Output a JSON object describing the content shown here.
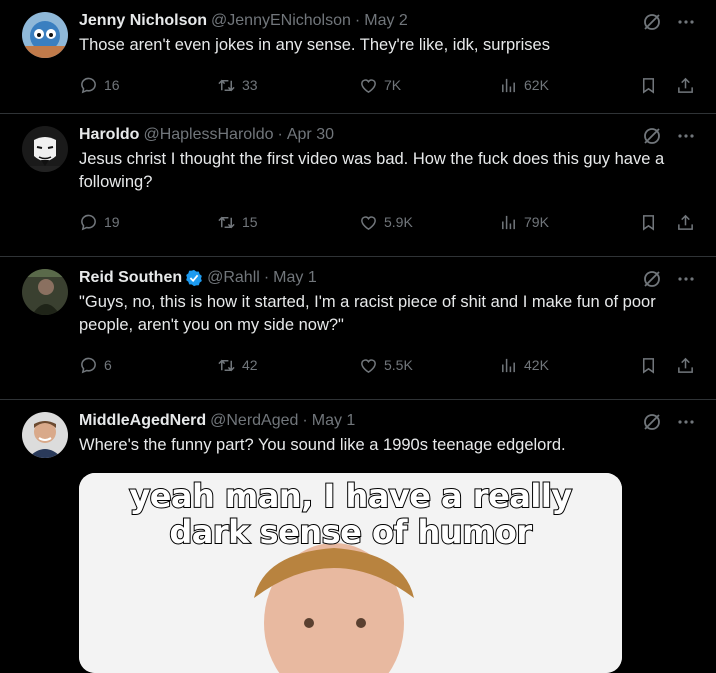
{
  "tweets": [
    {
      "name": "Jenny Nicholson",
      "handle": "@JennyENicholson",
      "date": "May 2",
      "verified": false,
      "text": "Those aren't even jokes in any sense. They're like, idk, surprises",
      "replies": "16",
      "retweets": "33",
      "likes": "7K",
      "views": "62K",
      "avatar": "avatar-photo"
    },
    {
      "name": "Haroldo",
      "handle": "@HaplessHaroldo",
      "date": "Apr 30",
      "verified": false,
      "text": "Jesus christ I thought the first video was bad. How the fuck does this guy have a following?",
      "replies": "19",
      "retweets": "15",
      "likes": "5.9K",
      "views": "79K",
      "avatar": "mask-avatar"
    },
    {
      "name": "Reid Southen",
      "handle": "@Rahll",
      "date": "May 1",
      "verified": true,
      "text": "\"Guys, no, this is how it started, I'm a racist piece of shit and I make fun of poor people, aren't you on my side now?\"",
      "replies": "6",
      "retweets": "42",
      "likes": "5.5K",
      "views": "42K",
      "avatar": "avatar-photo"
    },
    {
      "name": "MiddleAgedNerd",
      "handle": "@NerdAged",
      "date": "May 1",
      "verified": false,
      "text": "Where's the funny part? You sound like a 1990s teenage edgelord.",
      "avatar": "avatar-photo"
    }
  ],
  "meme": {
    "line1": "yeah man, I have a really",
    "line2": "dark sense of humor"
  },
  "colors": {
    "accent": "#1d9bf0",
    "muted": "#71767b",
    "divider": "#2f3336"
  }
}
